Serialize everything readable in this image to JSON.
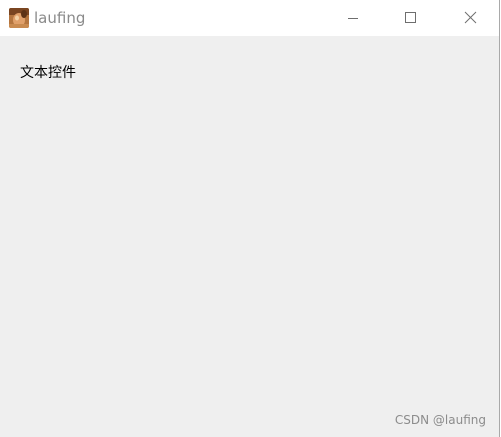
{
  "window": {
    "title": "laufing"
  },
  "titlebar": {
    "controls": [
      "minimize-icon",
      "maximize-icon",
      "close-icon"
    ]
  },
  "content": {
    "text_control": "文本控件"
  },
  "watermark": "CSDN @laufing",
  "colors": {
    "client_background": "#efefef",
    "titlebar_background": "#ffffff",
    "title_text": "#8a8a8a"
  }
}
